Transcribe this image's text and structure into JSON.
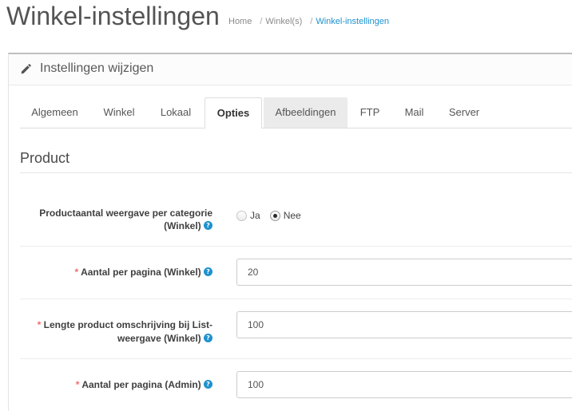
{
  "page": {
    "title": "Winkel-instellingen"
  },
  "breadcrumb": {
    "separator": "/",
    "items": [
      {
        "label": "Home"
      },
      {
        "label": "Winkel(s)"
      },
      {
        "label": "Winkel-instellingen",
        "current": true
      }
    ]
  },
  "panel": {
    "heading": "Instellingen wijzigen",
    "heading_icon": "pencil-icon"
  },
  "tabs": [
    {
      "label": "Algemeen"
    },
    {
      "label": "Winkel"
    },
    {
      "label": "Lokaal"
    },
    {
      "label": "Opties",
      "active": true
    },
    {
      "label": "Afbeeldingen",
      "highlighted": true
    },
    {
      "label": "FTP"
    },
    {
      "label": "Mail"
    },
    {
      "label": "Server"
    }
  ],
  "section": {
    "legend": "Product"
  },
  "fields": [
    {
      "label": "Productaantal weergave per categorie (Winkel)",
      "help_icon": "question-circle-icon",
      "options": [
        {
          "label": "Ja",
          "checked": false
        },
        {
          "label": "Nee",
          "checked": true
        }
      ]
    },
    {
      "label": "Aantal per pagina (Winkel)",
      "required_mark": "*",
      "help_icon": "question-circle-icon",
      "value": "20"
    },
    {
      "label": "Lengte product omschrijving bij List-weergave (Winkel)",
      "required_mark": "*",
      "help_icon": "question-circle-icon",
      "value": "100"
    },
    {
      "label": "Aantal per pagina (Admin)",
      "required_mark": "*",
      "help_icon": "question-circle-icon",
      "value": "100"
    }
  ],
  "colors": {
    "accent": "#1e91cf",
    "required": "#f56b6b",
    "panel_border": "#bfbfbf"
  }
}
